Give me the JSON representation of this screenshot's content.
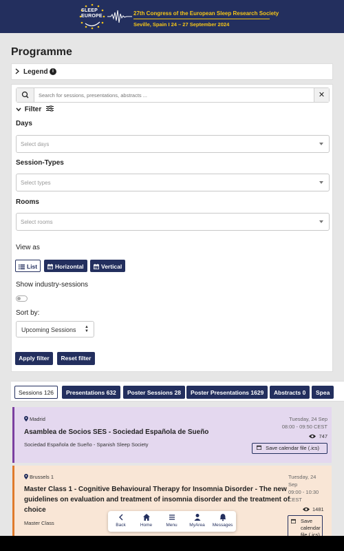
{
  "banner": {
    "logo_line1": "SLEEP",
    "logo_line2": "EUROPE",
    "title": "27th Congress of the European Sleep Research Society",
    "subtitle": "Seville, Spain I 24 – 27 September 2024"
  },
  "page": {
    "title": "Programme"
  },
  "legend": {
    "label": "Legend"
  },
  "search": {
    "placeholder": "Search for sessions, presentations, abstracts ..."
  },
  "filter": {
    "label": "Filter",
    "days_label": "Days",
    "days_placeholder": "Select days",
    "types_label": "Session-Types",
    "types_placeholder": "Select types",
    "rooms_label": "Rooms",
    "rooms_placeholder": "Select rooms",
    "view_label": "View as",
    "view_list": "List",
    "view_horizontal": "Horizontal",
    "view_vertical": "Vertical",
    "industry_label": "Show industry-sessions",
    "sort_label": "Sort by:",
    "sort_value": "Upcoming Sessions",
    "apply_label": "Apply filter",
    "reset_label": "Reset filter"
  },
  "tabs": [
    {
      "label": "Sessions 126"
    },
    {
      "label": "Presentations 632"
    },
    {
      "label": "Poster Sessions 28"
    },
    {
      "label": "Poster Presentations 1629"
    },
    {
      "label": "Abstracts 0"
    },
    {
      "label": "Spea"
    }
  ],
  "sessions": [
    {
      "room": "Madrid",
      "title": "Asamblea de Socios SES - Sociedad Española de Sueño",
      "subtitle": "Sociedad Española de Sueño - Spanish Sleep Society",
      "date": "Tuesday, 24 Sep",
      "time": "08:00 - 09:50 CEST",
      "views": "747",
      "calendar_label": "Save calendar file (.ics)",
      "color": "#7b3fa0"
    },
    {
      "room": "Brussels 1",
      "title_line1": "Master Class 1 - Cognitive Behavioural Therapy for Insomnia Disorder - The new",
      "title_line2": "guidelines on evaluation and treatment of insomnia disorder and the treatment of",
      "title_line3": "choice",
      "subtitle": "Master Class",
      "date_line1": "Tuesday, 24",
      "date_line2": "Sep",
      "time_line1": "09:00 - 10:30",
      "time_line2": "CEST",
      "views": "1481",
      "calendar_line1": "Save",
      "calendar_line2": "calendar",
      "calendar_line3": "file (.ics)",
      "color": "#e07a2b"
    }
  ],
  "nav": {
    "back": "Back",
    "home": "Home",
    "menu": "Menu",
    "myarea": "MyArea",
    "messages": "Messages"
  },
  "colors": {
    "navy": "#232f5e",
    "gold": "#f5c518"
  }
}
